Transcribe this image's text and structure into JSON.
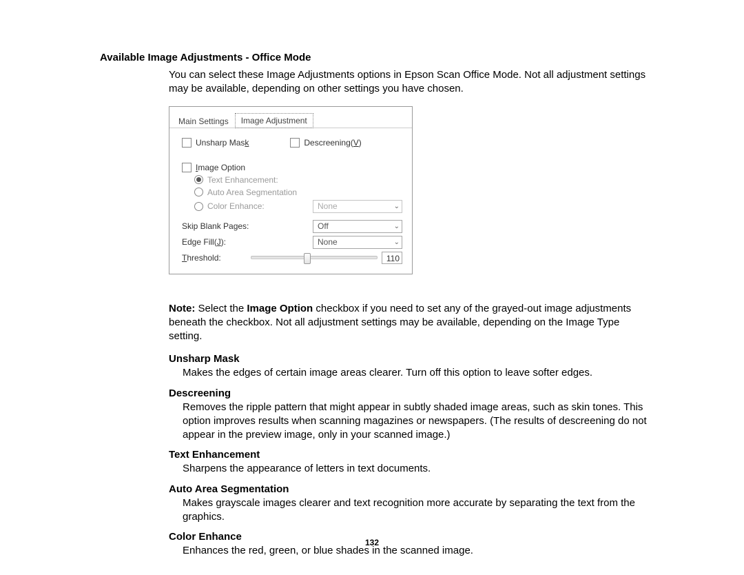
{
  "title": "Available Image Adjustments - Office Mode",
  "intro": "You can select these Image Adjustments options in Epson Scan Office Mode. Not all adjustment settings may be available, depending on other settings you have chosen.",
  "figure": {
    "tabs": {
      "main": "Main Settings",
      "adj": "Image Adjustment"
    },
    "unsharp": "Unsharp Mask",
    "descreen_pre": "Descreening(",
    "descreen_u": "V",
    "descreen_post": ")",
    "imgopt_u": "I",
    "imgopt_rest": "mage Option",
    "text_enh": "Text Enhancement:",
    "auto_seg": "Auto Area Segmentation",
    "color_enh": "Color Enhance:",
    "color_val": "None",
    "skip_label": "Skip Blank Pages:",
    "skip_val": "Off",
    "edge_pre": "Edge Fill(",
    "edge_u": "J",
    "edge_post": "):",
    "edge_val": "None",
    "thr_u": "T",
    "thr_rest": "hreshold:",
    "thr_val": "110"
  },
  "note_bold": "Note:",
  "note_mid1": " Select the ",
  "note_bold2": "Image Option",
  "note_rest": " checkbox if you need to set any of the grayed-out image adjustments beneath the checkbox. Not all adjustment settings may be available, depending on the Image Type setting.",
  "defs": {
    "unsharp_t": "Unsharp Mask",
    "unsharp_b": "Makes the edges of certain image areas clearer. Turn off this option to leave softer edges.",
    "descr_t": "Descreening",
    "descr_b": "Removes the ripple pattern that might appear in subtly shaded image areas, such as skin tones. This option improves results when scanning magazines or newspapers. (The results of descreening do not appear in the preview image, only in your scanned image.)",
    "text_t": "Text Enhancement",
    "text_b": "Sharpens the appearance of letters in text documents.",
    "auto_t": "Auto Area Segmentation",
    "auto_b": "Makes grayscale images clearer and text recognition more accurate by separating the text from the graphics.",
    "color_t": "Color Enhance",
    "color_b": "Enhances the red, green, or blue shades in the scanned image."
  },
  "pagenum": "132"
}
